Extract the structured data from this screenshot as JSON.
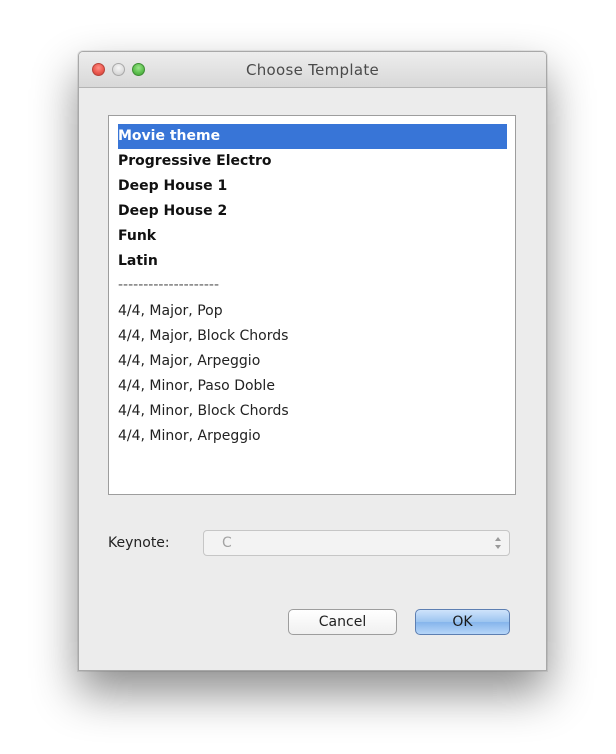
{
  "window": {
    "title": "Choose Template"
  },
  "templates": {
    "items": [
      {
        "label": "Movie theme",
        "bold": true,
        "selected": true
      },
      {
        "label": "Progressive Electro",
        "bold": true
      },
      {
        "label": "Deep House 1",
        "bold": true
      },
      {
        "label": "Deep House 2",
        "bold": true
      },
      {
        "label": "Funk",
        "bold": true
      },
      {
        "label": "Latin",
        "bold": true
      },
      {
        "label": "--------------------",
        "separator": true
      },
      {
        "label": "4/4, Major, Pop"
      },
      {
        "label": "4/4, Major, Block Chords"
      },
      {
        "label": "4/4, Major, Arpeggio"
      },
      {
        "label": "4/4, Minor, Paso Doble"
      },
      {
        "label": "4/4, Minor, Block Chords"
      },
      {
        "label": "4/4, Minor, Arpeggio"
      }
    ]
  },
  "keynote": {
    "label": "Keynote:",
    "value": "C"
  },
  "buttons": {
    "cancel": "Cancel",
    "ok": "OK"
  },
  "colors": {
    "selection": "#3875d7",
    "close": "#ec5a50",
    "zoom": "#5fc150"
  }
}
